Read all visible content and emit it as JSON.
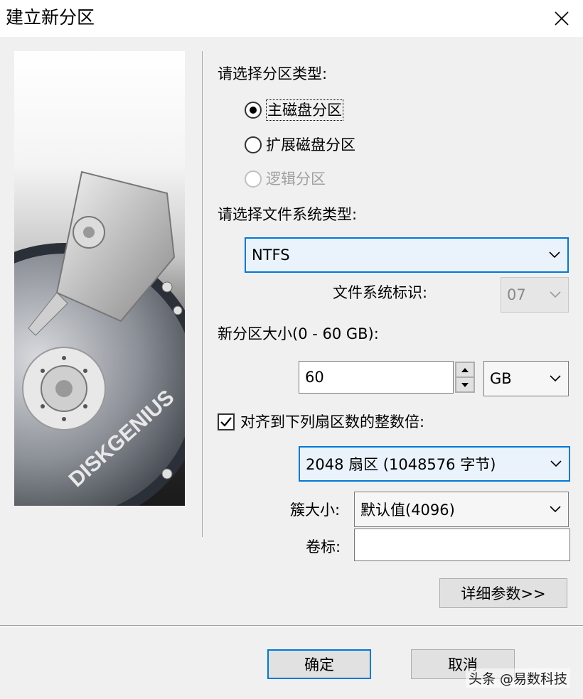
{
  "window": {
    "title": "建立新分区"
  },
  "image_panel": {
    "brand_text": "DISKGENIUS"
  },
  "partition_type": {
    "label": "请选择分区类型:",
    "options": [
      {
        "label": "主磁盘分区",
        "checked": true,
        "disabled": false
      },
      {
        "label": "扩展磁盘分区",
        "checked": false,
        "disabled": false
      },
      {
        "label": "逻辑分区",
        "checked": false,
        "disabled": true
      }
    ]
  },
  "filesystem": {
    "label": "请选择文件系统类型:",
    "selected": "NTFS",
    "id_label": "文件系统标识:",
    "id_value": "07"
  },
  "size": {
    "label": "新分区大小(0 - 60 GB):",
    "value": "60",
    "unit": "GB"
  },
  "alignment": {
    "checkbox_label": "对齐到下列扇区数的整数倍:",
    "checked": true,
    "selected": "2048 扇区 (1048576 字节)"
  },
  "cluster": {
    "label": "簇大小:",
    "selected": "默认值(4096)"
  },
  "volume": {
    "label": "卷标:",
    "value": ""
  },
  "buttons": {
    "details": "详细参数>>",
    "ok": "确定",
    "cancel": "取消"
  },
  "watermark": "头条 @易数科技"
}
